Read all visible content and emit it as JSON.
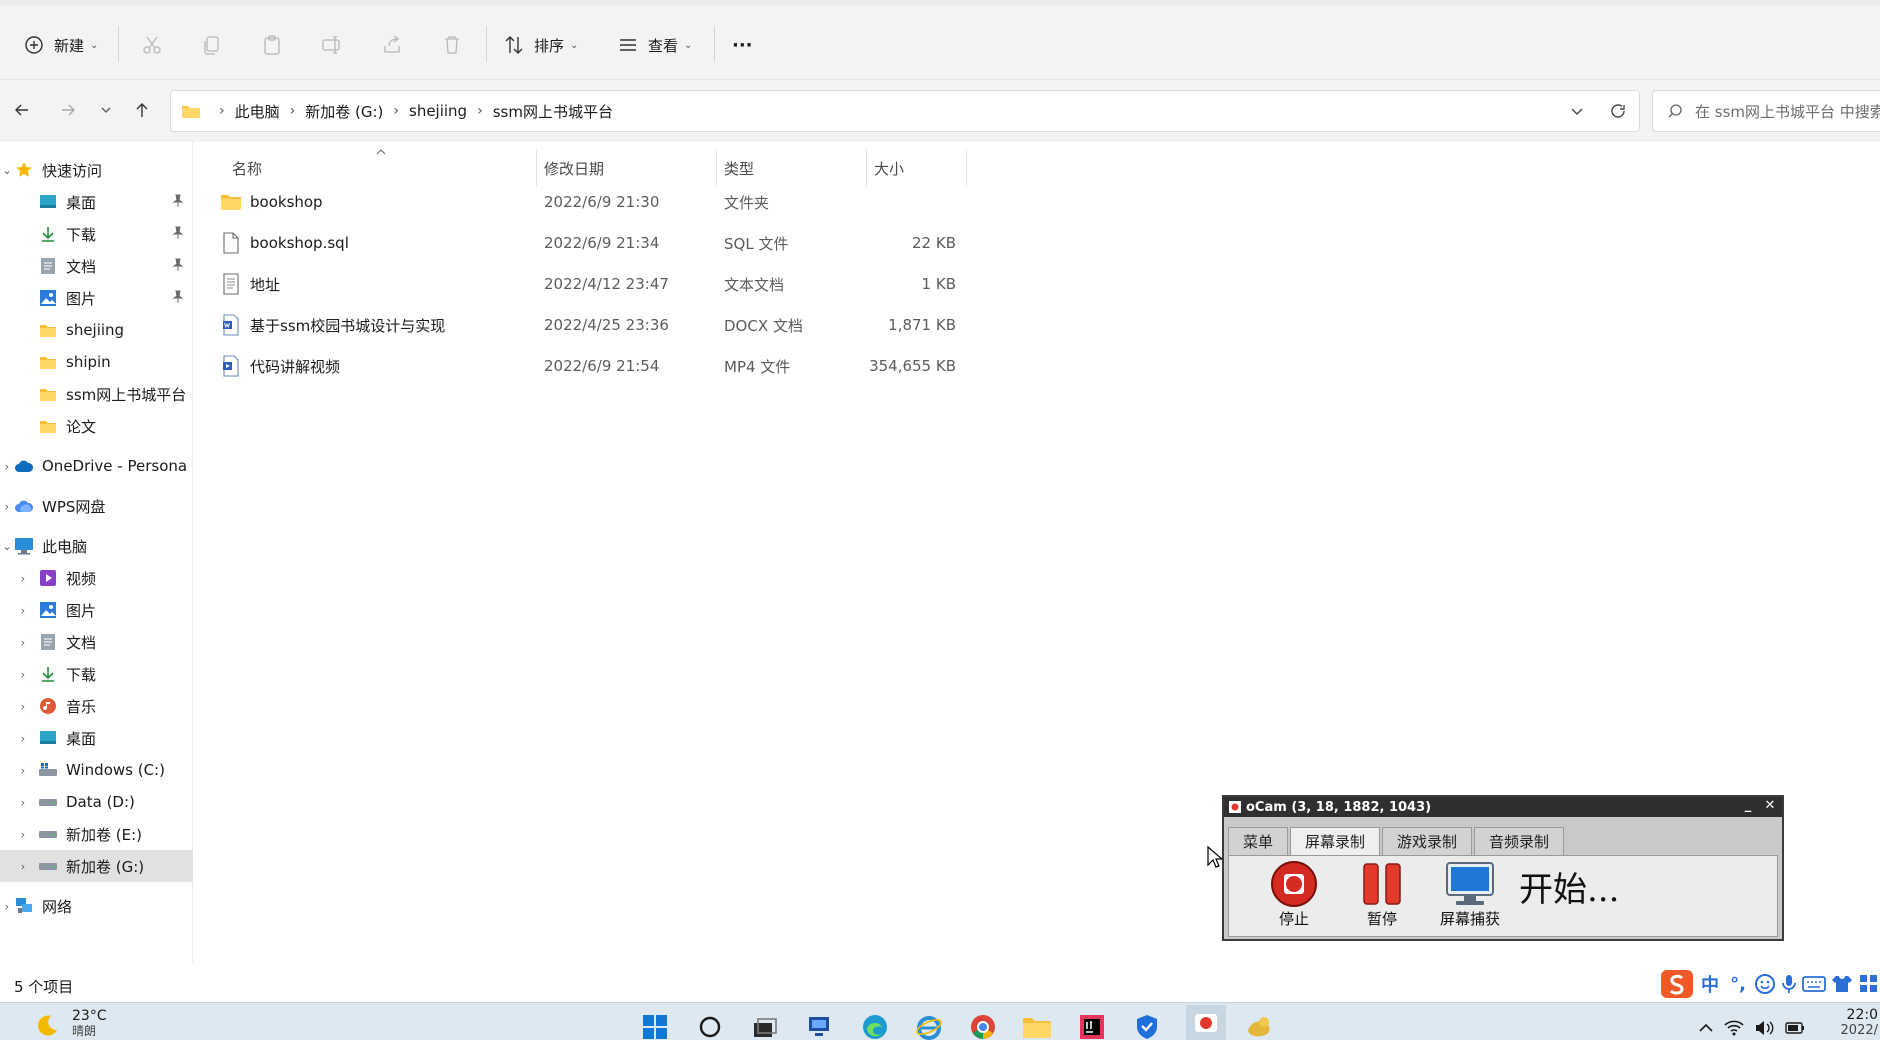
{
  "window": {
    "title": "ssm网上书城平台"
  },
  "toolbar": {
    "new_label": "新建",
    "sort_label": "排序",
    "view_label": "查看",
    "more_label": "···"
  },
  "address": {
    "crumbs": [
      "此电脑",
      "新加卷 (G:)",
      "shejiing",
      "ssm网上书城平台"
    ],
    "search_placeholder": "在 ssm网上书城平台 中搜索"
  },
  "sidebar": {
    "quick_access": "快速访问",
    "quick_items": [
      "桌面",
      "下载",
      "文档",
      "图片",
      "shejiing",
      "shipin",
      "ssm网上书城平台",
      "论文"
    ],
    "onedrive": "OneDrive - Persona",
    "wps": "WPS网盘",
    "this_pc": "此电脑",
    "pc_items": [
      "视频",
      "图片",
      "文档",
      "下载",
      "音乐",
      "桌面",
      "Windows (C:)",
      "Data (D:)",
      "新加卷 (E:)",
      "新加卷 (G:)"
    ],
    "network": "网络"
  },
  "columns": {
    "name": "名称",
    "date": "修改日期",
    "type": "类型",
    "size": "大小"
  },
  "files": [
    {
      "name": "bookshop",
      "date": "2022/6/9 21:30",
      "type": "文件夹",
      "size": "",
      "icon": "folder-icon"
    },
    {
      "name": "bookshop.sql",
      "date": "2022/6/9 21:34",
      "type": "SQL 文件",
      "size": "22 KB",
      "icon": "file-icon"
    },
    {
      "name": "地址",
      "date": "2022/4/12 23:47",
      "type": "文本文档",
      "size": "1 KB",
      "icon": "text-file-icon"
    },
    {
      "name": "基于ssm校园书城设计与实现",
      "date": "2022/4/25 23:36",
      "type": "DOCX 文档",
      "size": "1,871 KB",
      "icon": "word-doc-icon"
    },
    {
      "name": "代码讲解视频",
      "date": "2022/6/9 21:54",
      "type": "MP4 文件",
      "size": "354,655 KB",
      "icon": "video-file-icon"
    }
  ],
  "status": {
    "item_count": "5 个项目"
  },
  "taskbar": {
    "temperature": "23°C",
    "weather": "晴朗",
    "clock_time": "22:0",
    "clock_date": "2022/"
  },
  "ime": {
    "lang": "中",
    "punct": "°,"
  },
  "ocam": {
    "title": "oCam (3, 18, 1882, 1043)",
    "tabs": [
      "菜单",
      "屏幕录制",
      "游戏录制",
      "音频录制"
    ],
    "active_tab": 1,
    "stop_label": "停止",
    "pause_label": "暂停",
    "capture_label": "屏幕捕获",
    "status_text": "开始..."
  }
}
